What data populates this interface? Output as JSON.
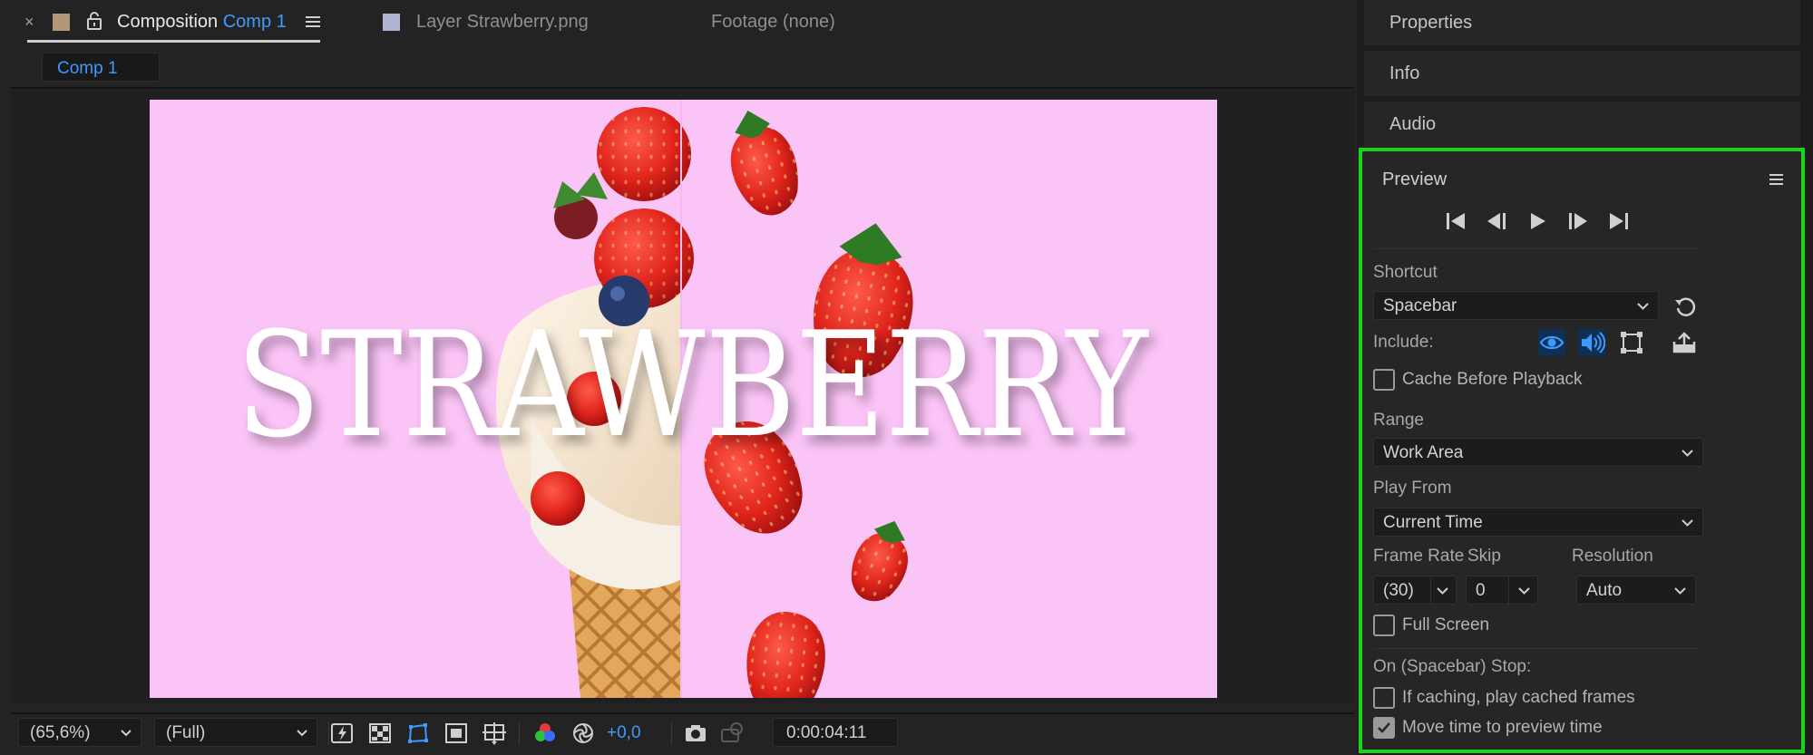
{
  "comp_panel": {
    "tabs": {
      "composition_prefix": "Composition",
      "composition_name": "Comp 1",
      "layer_label": "Layer Strawberry.png",
      "footage_label": "Footage (none)"
    },
    "active_comp_tab": "Comp 1",
    "canvas": {
      "headline": "STRAWBERRY",
      "background_color": "#fbc4f7"
    }
  },
  "viewer_toolbar": {
    "zoom": "(65,6%)",
    "resolution": "(Full)",
    "exposure": "+0,0",
    "timecode": "0:00:04:11"
  },
  "right_panels": {
    "properties": "Properties",
    "info": "Info",
    "audio": "Audio"
  },
  "preview": {
    "title": "Preview",
    "shortcut_label": "Shortcut",
    "shortcut_value": "Spacebar",
    "include_label": "Include:",
    "cache_before_playback": "Cache Before Playback",
    "range_label": "Range",
    "range_value": "Work Area",
    "play_from_label": "Play From",
    "play_from_value": "Current Time",
    "frame_rate_label": "Frame Rate",
    "frame_rate_value": "(30)",
    "skip_label": "Skip",
    "skip_value": "0",
    "resolution_label": "Resolution",
    "resolution_value": "Auto",
    "full_screen": "Full Screen",
    "on_stop_label": "On (Spacebar) Stop:",
    "if_caching": "If caching, play cached frames",
    "move_time": "Move time to preview time"
  },
  "colors": {
    "accent_blue": "#3d9bff",
    "highlight_green": "#16d616",
    "canvas_pink": "#fbc4f7"
  }
}
